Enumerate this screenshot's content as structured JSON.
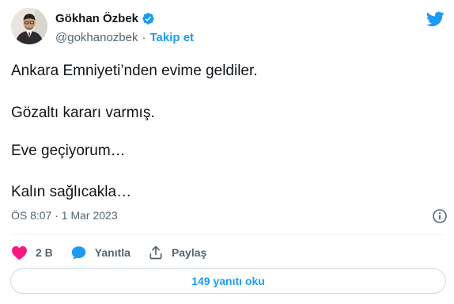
{
  "author": {
    "name": "Gökhan Özbek",
    "handle": "@gokhanozbek",
    "separator": "·",
    "follow_label": "Takip et"
  },
  "tweet": {
    "lines": [
      "Ankara Emniyeti’nden evime geldiler.",
      "Gözaltı kararı varmış.",
      "Eve geçiyorum…",
      "Kalın sağlıcakla…"
    ],
    "timestamp": "ÖS 8:07 · 1 Mar 2023"
  },
  "actions": {
    "likes_count": "2 B",
    "reply_label": "Yanıtla",
    "share_label": "Paylaş"
  },
  "replies_button_label": "149 yanıtı oku",
  "icons": {
    "brand": "twitter-bird-icon",
    "verified": "verified-badge-icon",
    "info": "info-icon",
    "like": "heart-icon",
    "reply": "reply-bubble-icon",
    "share": "share-icon"
  },
  "colors": {
    "accent": "#1d9bf0",
    "like": "#f91880",
    "text": "#0f1419",
    "secondary": "#536471",
    "border": "#cfd9de"
  }
}
